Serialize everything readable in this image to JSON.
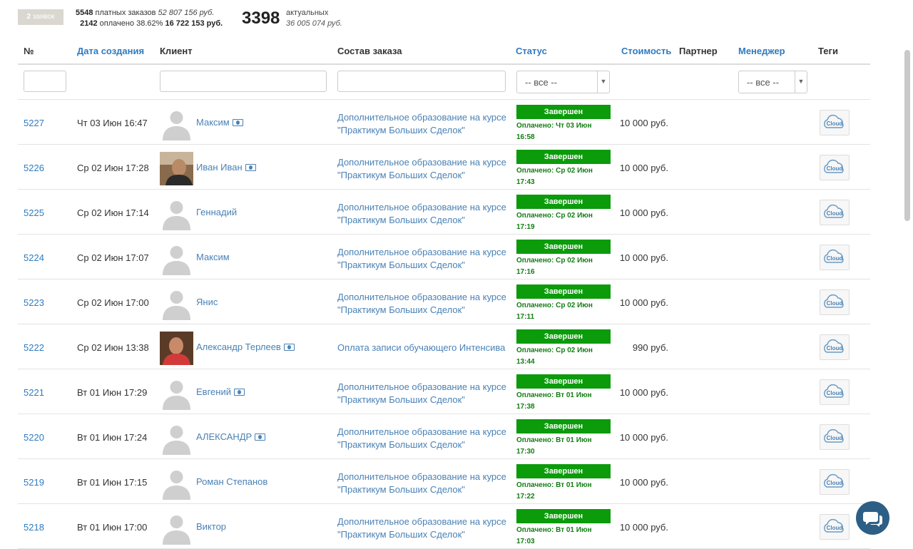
{
  "summary": {
    "badge_count": "2",
    "badge_label": "заявок",
    "paid_orders_count": "5548",
    "paid_orders_label": "платных заказов",
    "paid_orders_sum": "52 807 156 руб.",
    "paid_count": "2142",
    "paid_label": "оплачено 38.62%",
    "paid_sum": "16 722 153 руб.",
    "actual_count": "3398",
    "actual_label": "актуальных",
    "actual_sum": "36 005 074 руб."
  },
  "columns": {
    "id": "№",
    "created": "Дата создания",
    "client": "Клиент",
    "order": "Состав заказа",
    "status": "Статус",
    "cost": "Стоимость",
    "partner": "Партнер",
    "manager": "Менеджер",
    "tags": "Теги"
  },
  "filters": {
    "status_select": "-- все --",
    "manager_select": "-- все --"
  },
  "rows": [
    {
      "id": "5227",
      "date": "Чт 03 Июн 16:47",
      "client": "Максим",
      "cash": true,
      "avatar": "placeholder",
      "order": "Дополнительное образование на курсе \"Практикум Больших Сделок\"",
      "status": "Завершен",
      "paid": "Оплачено: Чт 03 Июн 16:58",
      "cost": "10 000 руб."
    },
    {
      "id": "5226",
      "date": "Ср 02 Июн 17:28",
      "client": "Иван Иван",
      "cash": true,
      "avatar": "photo",
      "order": "Дополнительное образование на курсе \"Практикум Больших Сделок\"",
      "status": "Завершен",
      "paid": "Оплачено: Ср 02 Июн 17:43",
      "cost": "10 000 руб."
    },
    {
      "id": "5225",
      "date": "Ср 02 Июн 17:14",
      "client": "Геннадий",
      "cash": false,
      "avatar": "placeholder",
      "order": "Дополнительное образование на курсе \"Практикум Больших Сделок\"",
      "status": "Завершен",
      "paid": "Оплачено: Ср 02 Июн 17:19",
      "cost": "10 000 руб."
    },
    {
      "id": "5224",
      "date": "Ср 02 Июн 17:07",
      "client": "Максим",
      "cash": false,
      "avatar": "placeholder",
      "order": "Дополнительное образование на курсе \"Практикум Больших Сделок\"",
      "status": "Завершен",
      "paid": "Оплачено: Ср 02 Июн 17:16",
      "cost": "10 000 руб."
    },
    {
      "id": "5223",
      "date": "Ср 02 Июн 17:00",
      "client": "Янис",
      "cash": false,
      "avatar": "placeholder",
      "order": "Дополнительное образование на курсе \"Практикум Больших Сделок\"",
      "status": "Завершен",
      "paid": "Оплачено: Ср 02 Июн 17:11",
      "cost": "10 000 руб."
    },
    {
      "id": "5222",
      "date": "Ср 02 Июн 13:38",
      "client": "Александр Терлеев",
      "cash": true,
      "avatar": "photo2",
      "order": "Оплата записи обучающего Интенсива",
      "status": "Завершен",
      "paid": "Оплачено: Ср 02 Июн 13:44",
      "cost": "990 руб."
    },
    {
      "id": "5221",
      "date": "Вт 01 Июн 17:29",
      "client": "Евгений",
      "cash": true,
      "avatar": "placeholder",
      "order": "Дополнительное образование на курсе \"Практикум Больших Сделок\"",
      "status": "Завершен",
      "paid": "Оплачено: Вт 01 Июн 17:38",
      "cost": "10 000 руб."
    },
    {
      "id": "5220",
      "date": "Вт 01 Июн 17:24",
      "client": "АЛЕКСАНДР",
      "cash": true,
      "avatar": "placeholder",
      "order": "Дополнительное образование на курсе \"Практикум Больших Сделок\"",
      "status": "Завершен",
      "paid": "Оплачено: Вт 01 Июн 17:30",
      "cost": "10 000 руб."
    },
    {
      "id": "5219",
      "date": "Вт 01 Июн 17:15",
      "client": "Роман Степанов",
      "cash": false,
      "avatar": "placeholder",
      "order": "Дополнительное образование на курсе \"Практикум Больших Сделок\"",
      "status": "Завершен",
      "paid": "Оплачено: Вт 01 Июн 17:22",
      "cost": "10 000 руб."
    },
    {
      "id": "5218",
      "date": "Вт 01 Июн 17:00",
      "client": "Виктор",
      "cash": false,
      "avatar": "placeholder",
      "order": "Дополнительное образование на курсе \"Практикум Больших Сделок\"",
      "status": "Завершен",
      "paid": "Оплачено: Вт 01 Июн 17:03",
      "cost": "10 000 руб."
    }
  ],
  "tag_label": "Cloud",
  "colors": {
    "link": "#2f7bbf",
    "status_green": "#0b9b0b",
    "chat_button": "#2d5f86"
  }
}
